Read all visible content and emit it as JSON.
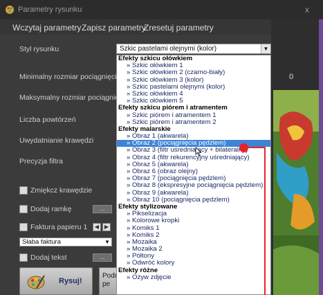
{
  "window": {
    "title": "Parametry rysunku",
    "close_glyph": "x"
  },
  "menu": [
    "Wczytaj parametry",
    "Zapisz parametry",
    "Zresetuj parametry"
  ],
  "labels": {
    "styl": "Styl rysunku",
    "min": "Minimalny rozmiar pociągnięci",
    "max": "Maksymalny rozmiar pociągnię",
    "liczba": "Liczba powtórzeń",
    "uwydatnianie": "Uwydatnianie krawędzi",
    "precyzja": "Precyzja filtra",
    "zmiekcz": "Zmiękcz krawędzie",
    "ramka": "Dodaj ramkę",
    "faktura": "Faktura papieru 1",
    "tekst": "Dodaj tekst"
  },
  "style_select": {
    "value": "Szkic pastelami olejnymi (kolor)"
  },
  "texture_select": {
    "value": "Słaba faktura"
  },
  "right_value": "0",
  "buttons": {
    "rysuj": "Rysuj!",
    "ellipsis": "...",
    "partial_line1": "Podr",
    "partial_line2": "pe"
  },
  "dropdown": [
    {
      "type": "group",
      "text": "Efekty szkicu ołówkiem"
    },
    {
      "type": "item",
      "text": "» Szkic ołówkiem 1"
    },
    {
      "type": "item",
      "text": "» Szkic ołówkiem 2 (czarno-biały)"
    },
    {
      "type": "item",
      "text": "» Szkic ołówkiem 3 (kolor)"
    },
    {
      "type": "item",
      "text": "» Szkic pastelami olejnymi (kolor)"
    },
    {
      "type": "item",
      "text": "» Szkic ołówkiem 4"
    },
    {
      "type": "item",
      "text": "» Szkic ołówkiem 5"
    },
    {
      "type": "group",
      "text": "Efekty szkicu piórem i atramentem"
    },
    {
      "type": "item",
      "text": "» Szkic piórem i atramentem 1"
    },
    {
      "type": "item",
      "text": "» Szkic piórem i atramentem 2"
    },
    {
      "type": "group",
      "text": "Efekty malarskie"
    },
    {
      "type": "item",
      "text": "» Obraz 1 (akwarela)"
    },
    {
      "type": "item",
      "text": "» Obraz 2 (pociągnięcia pędzlem)",
      "selected": true
    },
    {
      "type": "item",
      "text": "» Obraz 3 (filtr uśredniający + bilateralny)"
    },
    {
      "type": "item",
      "text": "» Obraz 4 (filtr rekurencyjny uśredniający)"
    },
    {
      "type": "item",
      "text": "» Obraz 5 (akwarela)"
    },
    {
      "type": "item",
      "text": "» Obraz 6 (obraz olejny)"
    },
    {
      "type": "item",
      "text": "» Obraz 7 (pociągnięcia pędzlem)"
    },
    {
      "type": "item",
      "text": "» Obraz 8 (ekspresyjne pociągnięcia pędzlem)"
    },
    {
      "type": "item",
      "text": "» Obraz 9 (akwarela)"
    },
    {
      "type": "item",
      "text": "» Obraz 10 (pociągnięcia pędzlem)"
    },
    {
      "type": "group",
      "text": "Efekty stylizowane"
    },
    {
      "type": "item",
      "text": "» Pikselizacja"
    },
    {
      "type": "item",
      "text": "» Kolorowe kropki"
    },
    {
      "type": "item",
      "text": "» Komiks 1"
    },
    {
      "type": "item",
      "text": "» Komiks 2"
    },
    {
      "type": "item",
      "text": "» Mozaika"
    },
    {
      "type": "item",
      "text": "» Mozaika 2"
    },
    {
      "type": "item",
      "text": "» Półtony"
    },
    {
      "type": "item",
      "text": "» Odwróć kolory"
    },
    {
      "type": "group",
      "text": "Efekty różne"
    },
    {
      "type": "item",
      "text": "» Ożyw zdjęcie"
    }
  ],
  "colors": {
    "selection": "#3d84d6",
    "annotation": "#e8222a",
    "group_text": "#000000",
    "item_text": "#1a2a66"
  },
  "icons": [
    "app-icon",
    "close-icon",
    "dropdown-arrow-icon",
    "arrow-left-icon",
    "arrow-right-icon",
    "palette-icon",
    "cursor-icon"
  ]
}
